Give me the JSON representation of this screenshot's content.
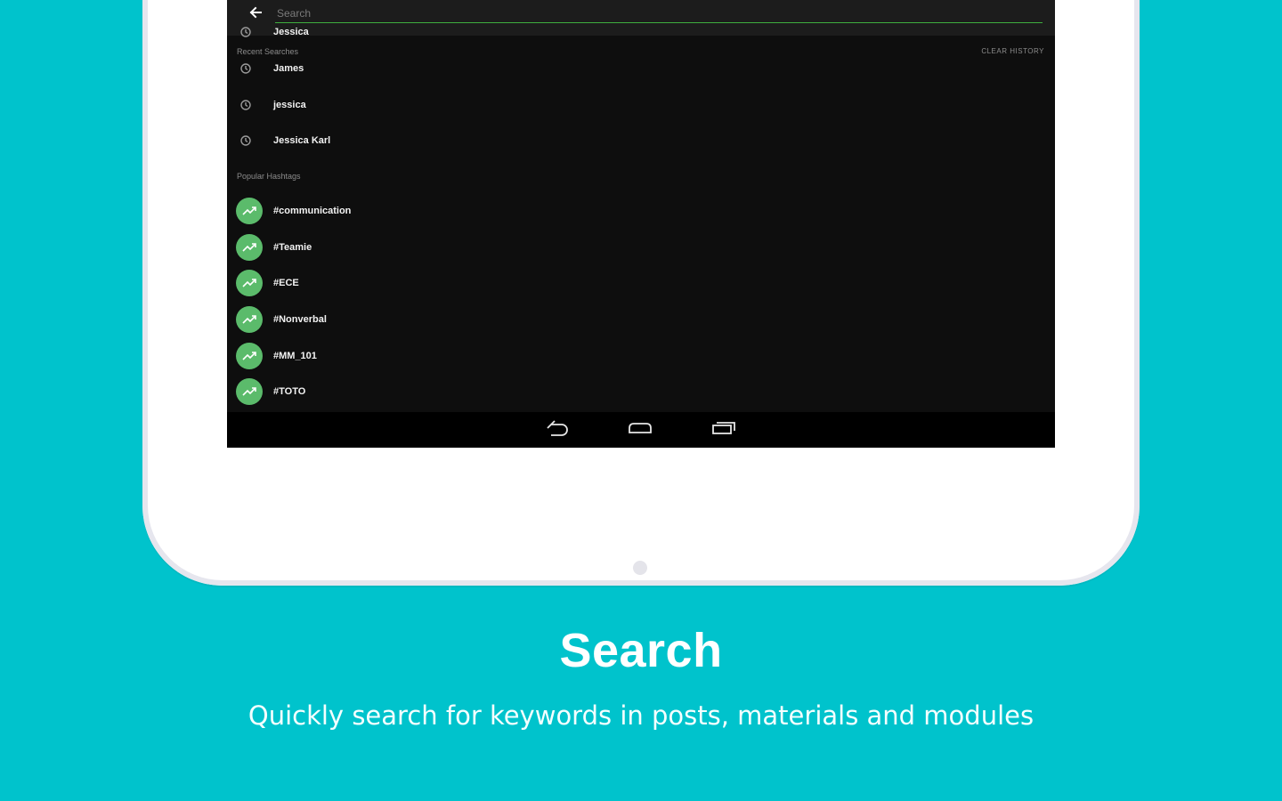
{
  "search": {
    "placeholder": "Search",
    "value": ""
  },
  "recent": {
    "header": "Recent Searches",
    "clear_label": "CLEAR HISTORY",
    "items": [
      {
        "label": "Jessica"
      },
      {
        "label": "James"
      },
      {
        "label": "jessica"
      },
      {
        "label": "Jessica Karl"
      }
    ]
  },
  "popular": {
    "header": "Popular Hashtags",
    "items": [
      {
        "label": "#communication"
      },
      {
        "label": "#Teamie"
      },
      {
        "label": "#ECE"
      },
      {
        "label": "#Nonverbal"
      },
      {
        "label": "#MM_101"
      },
      {
        "label": "#TOTO"
      }
    ]
  },
  "nav": {
    "back_icon": "nav-back-icon",
    "home_icon": "nav-home-icon",
    "recents_icon": "nav-recents-icon"
  },
  "caption": {
    "title": "Search",
    "subtitle": "Quickly search for keywords in posts, materials and modules"
  },
  "colors": {
    "background": "#00c3cc",
    "accent_green": "#5bbb6b",
    "screen_bg": "#0e0e0e"
  }
}
